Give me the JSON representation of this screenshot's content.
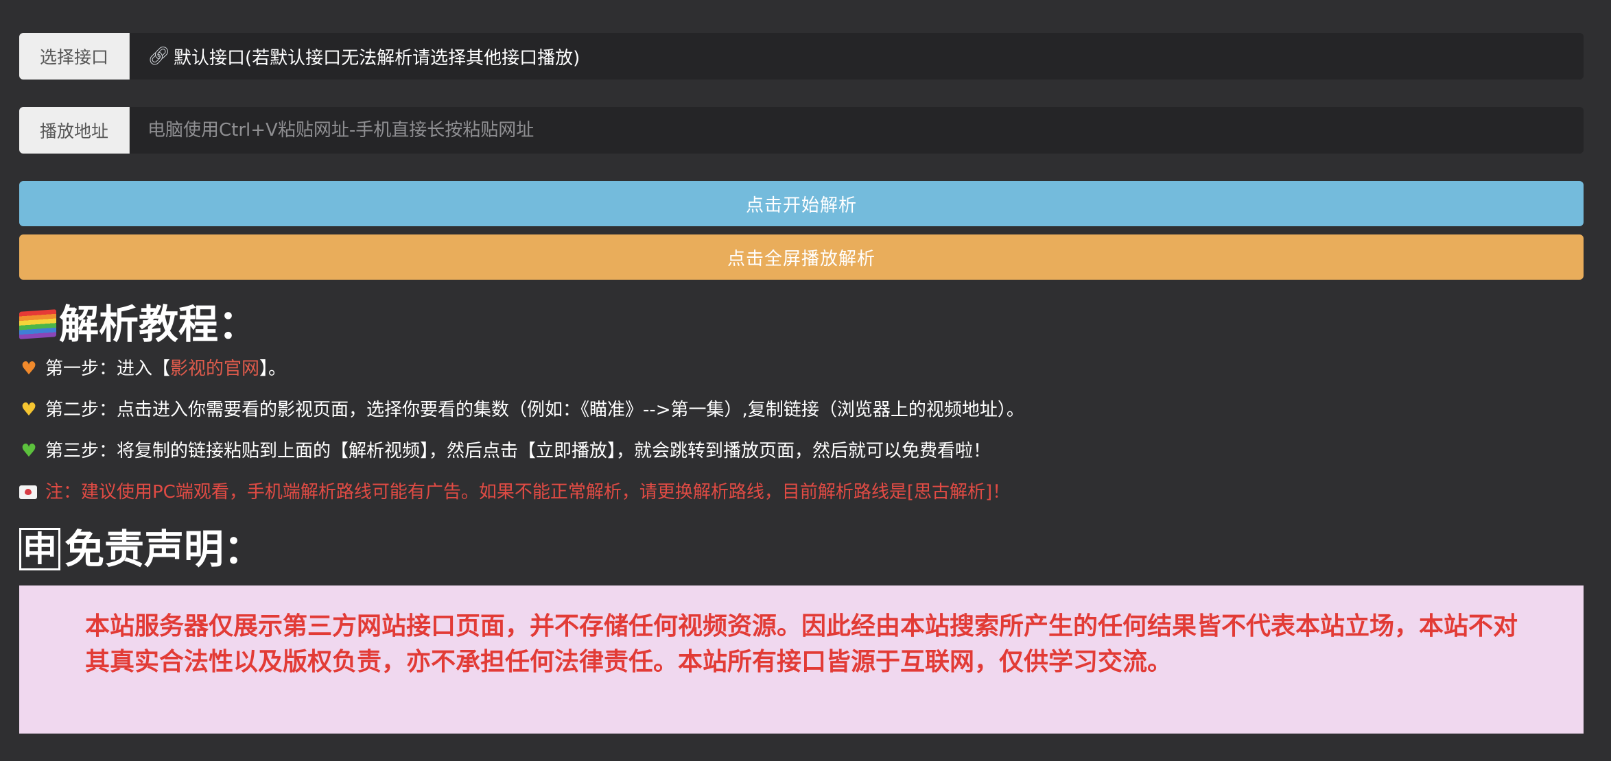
{
  "interface_select": {
    "label": "选择接口",
    "icon": "link-icon",
    "value": "默认接口(若默认接口无法解析请选择其他接口播放)"
  },
  "play_address": {
    "label": "播放地址",
    "placeholder": "电脑使用Ctrl+V粘贴网址-手机直接长按粘贴网址"
  },
  "buttons": {
    "parse": "点击开始解析",
    "fullscreen": "点击全屏播放解析"
  },
  "tutorial": {
    "title": "解析教程：",
    "step1": {
      "prefix": "第一步：进入【",
      "link": "影视的官网",
      "suffix": "】。"
    },
    "step2": "第二步：点击进入你需要看的影视页面，选择你要看的集数（例如：《瞄准》-->第一集）,复制链接（浏览器上的视频地址）。",
    "step3": "第三步：将复制的链接粘贴到上面的【解析视频】，然后点击【立即播放】，就会跳转到播放页面，然后就可以免费看啦！",
    "note": "注：建议使用PC端观看，手机端解析路线可能有广告。如果不能正常解析，请更换解析路线，目前解析路线是[思古解析]！"
  },
  "disclaimer": {
    "badge": "申",
    "title": "免责声明：",
    "text": "本站服务器仅展示第三方网站接口页面，并不存储任何视频资源。因此经由本站搜索所产生的任何结果皆不代表本站立场，本站不对其真实合法性以及版权负责，亦不承担任何法律责任。本站所有接口皆源于互联网，仅供学习交流。"
  },
  "colors": {
    "background": "#2f2f31",
    "parse_button": "#74bbdc",
    "fullscreen_button": "#e9ad5b",
    "disclaimer_bg": "#f0d8ef",
    "disclaimer_text": "#e23b36",
    "note_text": "#e14b44"
  }
}
